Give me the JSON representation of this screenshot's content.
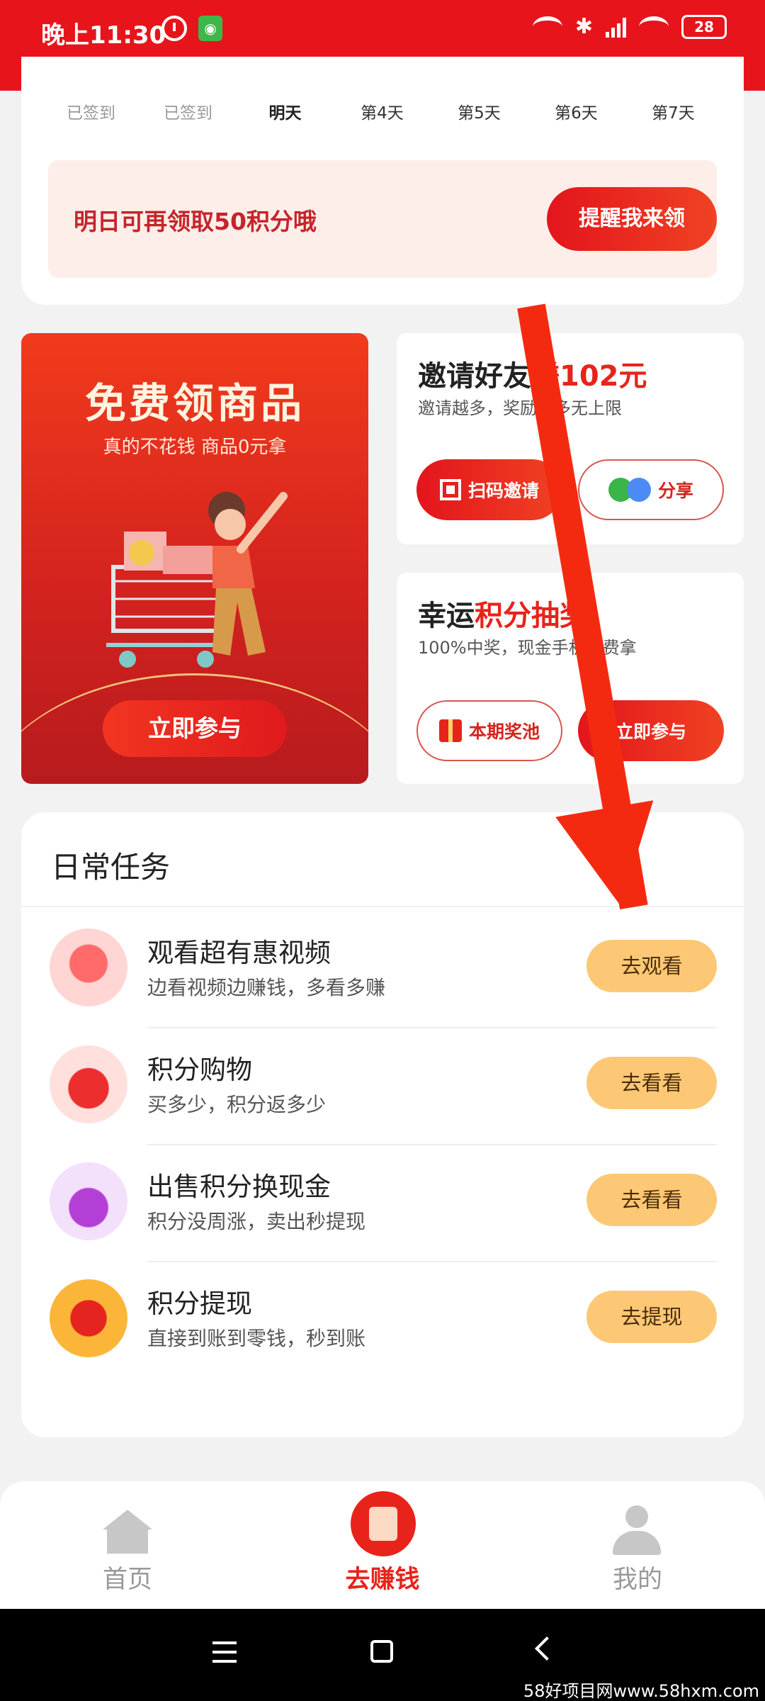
{
  "status_bar": {
    "time": "晚上11:30",
    "battery": "28"
  },
  "signin": {
    "days": [
      "已签到",
      "已签到",
      "明天",
      "第4天",
      "第5天",
      "第6天",
      "第7天"
    ],
    "remind_text": "明日可再领取50积分哦",
    "remind_button": "提醒我来领"
  },
  "free_goods": {
    "title": "免费领商品",
    "subtitle": "真的不花钱 商品0元拿",
    "button": "立即参与"
  },
  "invite": {
    "title_prefix": "邀请好友",
    "title_highlight": "赚102元",
    "subtitle": "邀请越多，奖励越多无上限",
    "scan_button": "扫码邀请",
    "share_button": "分享"
  },
  "lottery": {
    "title_prefix": "幸运",
    "title_highlight": "积分抽奖",
    "subtitle": "100%中奖，现金手机免费拿",
    "pool_button": "本期奖池",
    "join_button": "立即参与"
  },
  "daily_tasks": {
    "title": "日常任务",
    "items": [
      {
        "name": "观看超有惠视频",
        "desc": "边看视频边赚钱，多看多赚",
        "button": "去观看",
        "icon": "video-icon"
      },
      {
        "name": "积分购物",
        "desc": "买多少，积分返多少",
        "button": "去看看",
        "icon": "shopping-bag-icon"
      },
      {
        "name": "出售积分换现金",
        "desc": "积分没周涨，卖出秒提现",
        "button": "去看看",
        "icon": "coin-bag-icon"
      },
      {
        "name": "积分提现",
        "desc": "直接到账到零钱，秒到账",
        "button": "去提现",
        "icon": "red-envelope-icon"
      }
    ]
  },
  "bottom_nav": {
    "items": [
      {
        "label": "首页"
      },
      {
        "label": "去赚钱"
      },
      {
        "label": "我的"
      }
    ]
  },
  "watermark": "58好项目网www.58hxm.com",
  "colors": {
    "brand_red": "#e8141b",
    "task_button": "#fdc875",
    "arrow": "#f42a10"
  }
}
